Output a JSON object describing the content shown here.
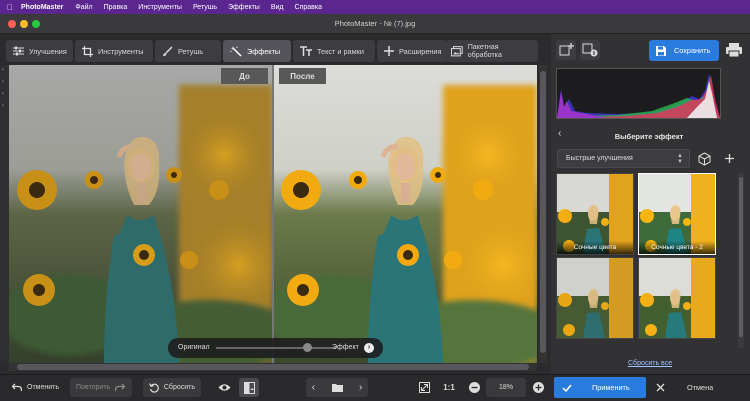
{
  "menubar": {
    "app_name": "PhotoMaster",
    "items": [
      "Файл",
      "Правка",
      "Инструменты",
      "Ретушь",
      "Эффекты",
      "Вид",
      "Справка"
    ]
  },
  "window": {
    "title": "PhotoMaster - № (7).jpg"
  },
  "tabs": [
    {
      "label": "Улучшения",
      "icon": "sliders-icon"
    },
    {
      "label": "Инструменты",
      "icon": "crop-icon"
    },
    {
      "label": "Ретушь",
      "icon": "brush-icon"
    },
    {
      "label": "Эффекты",
      "icon": "magic-wand-icon",
      "active": true
    },
    {
      "label": "Текст и рамки",
      "icon": "text-icon"
    },
    {
      "label": "Расширения",
      "icon": "plus-icon"
    }
  ],
  "batch": {
    "label": "Пакетная обработка"
  },
  "header_right": {
    "save_label": "Сохранить"
  },
  "compare": {
    "before_label": "До",
    "after_label": "После"
  },
  "effect_slider": {
    "left_label": "Оригинал",
    "right_label": "Эффект",
    "value_fraction": 0.76
  },
  "effects_panel": {
    "title": "Выберите эффект",
    "category": "Быстрые улучшения",
    "thumbnails": [
      {
        "label": "Сочные цвета"
      },
      {
        "label": "Сочные цвета - 2"
      },
      {
        "label": ""
      },
      {
        "label": ""
      }
    ],
    "reset_all": "Сбросить все"
  },
  "bottom": {
    "undo": "Отменить",
    "redo": "Повторить",
    "reset": "Сбросить",
    "zoom_ratio": "1:1",
    "zoom_value": "18%",
    "apply": "Применить",
    "cancel": "Отмена"
  },
  "colors": {
    "accent": "#2a7bde",
    "menubar": "#5b2690",
    "panel": "#323235",
    "toolbar_btn": "#3d3d41"
  }
}
